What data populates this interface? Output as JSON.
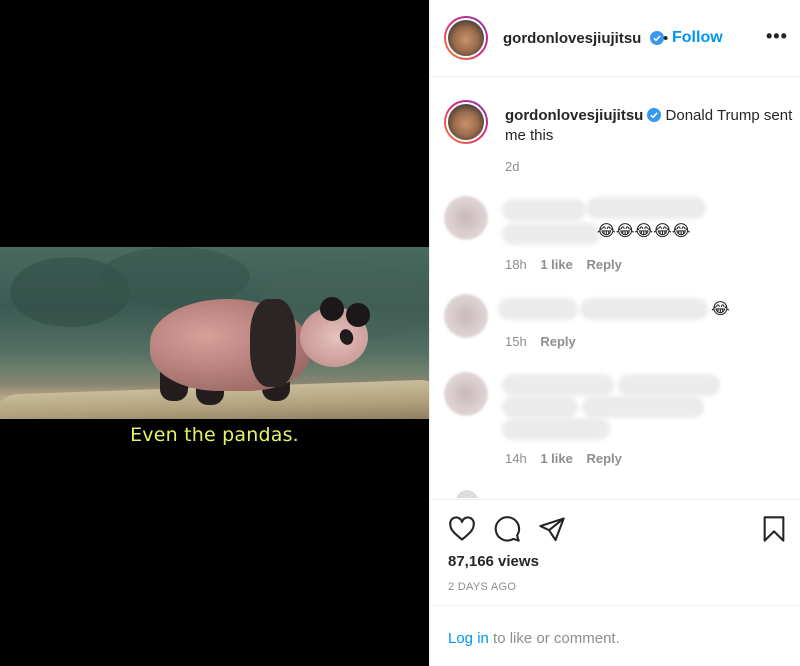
{
  "media": {
    "caption": "Even the pandas."
  },
  "header": {
    "username": "gordonlovesjiujitsu",
    "separator": "•",
    "follow_label": "Follow",
    "more_label": "•••"
  },
  "post_caption": {
    "username": "gordonlovesjiujitsu",
    "text": "Donald Trump sent me this",
    "age": "2d"
  },
  "comments": [
    {
      "emoji": "😂😂😂😂😂",
      "age": "18h",
      "likes": "1 like",
      "reply": "Reply"
    },
    {
      "emoji": "😂",
      "age": "15h",
      "likes": "",
      "reply": "Reply"
    },
    {
      "emoji": "",
      "age": "14h",
      "likes": "1 like",
      "reply": "Reply"
    }
  ],
  "actions": {
    "icons": [
      "heart-icon",
      "comment-icon",
      "share-icon",
      "bookmark-icon"
    ],
    "views": "87,166 views",
    "time_ago": "2 DAYS AGO"
  },
  "login": {
    "link": "Log in",
    "rest": " to like or comment."
  },
  "colors": {
    "accent": "#0095f6",
    "verified": "#3897f0",
    "caption_yellow": "#e8f06a",
    "muted": "#8e8e8e"
  }
}
